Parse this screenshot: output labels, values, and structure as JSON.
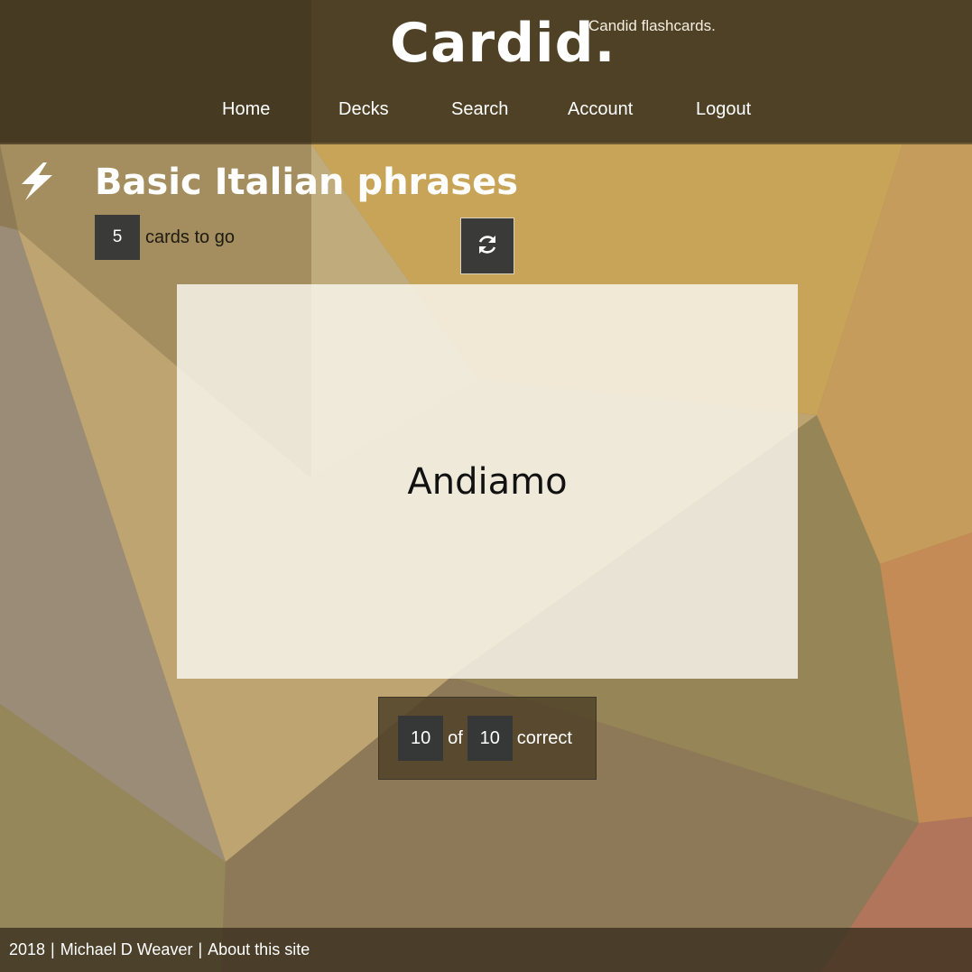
{
  "header": {
    "brand": "Cardid.",
    "tagline": "Candid flashcards.",
    "nav": [
      {
        "label": "Home"
      },
      {
        "label": "Decks"
      },
      {
        "label": "Search"
      },
      {
        "label": "Account"
      },
      {
        "label": "Logout"
      }
    ]
  },
  "study": {
    "icon": "lightning-bolt-icon",
    "deck_title": "Basic Italian phrases",
    "cards_remaining": "5",
    "cards_remaining_label": "cards to go",
    "refresh_icon": "refresh-icon"
  },
  "card": {
    "text": "Andiamo"
  },
  "score": {
    "correct": "10",
    "of_word": "of",
    "total": "10",
    "correct_word": "correct"
  },
  "footer": {
    "year": "2018",
    "sep1": "|",
    "author": "Michael D Weaver",
    "sep2": "|",
    "about": "About this site"
  },
  "colors": {
    "header_overlay": "#372d19",
    "dark_box": "#3a3a38",
    "card_bg": "#faf8f0"
  }
}
